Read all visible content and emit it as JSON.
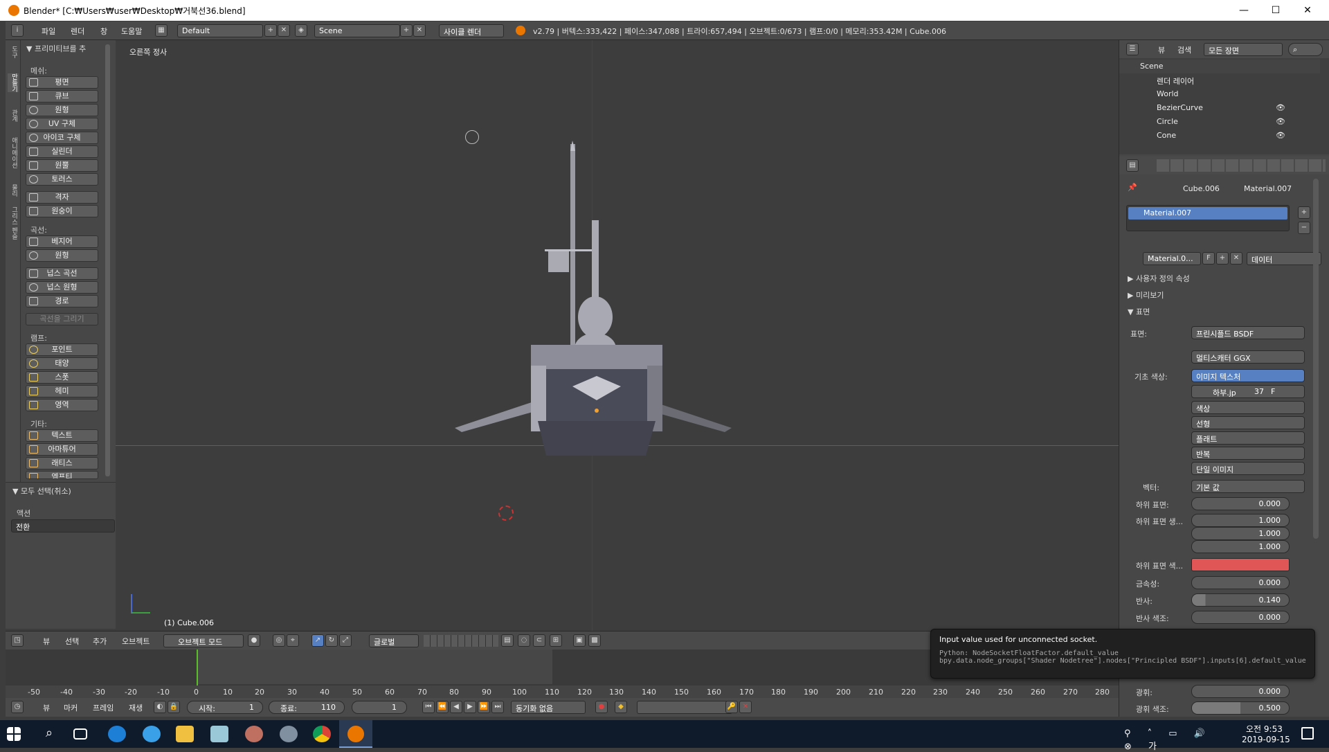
{
  "window": {
    "title": "Blender* [C:₩Users₩user₩Desktop₩거북선36.blend]",
    "min": "—",
    "max": "☐",
    "close": "✕"
  },
  "infobar": {
    "menus": [
      "파일",
      "렌더",
      "창",
      "도움말"
    ],
    "layout": "Default",
    "scene": "Scene",
    "engine": "사이클 렌더",
    "stats": "v2.79 | 버텍스:333,422 | 페이스:347,088 | 트라이:657,494 | 오브젝트:0/673 | 램프:0/0 | 메모리:353.42M | Cube.006"
  },
  "toolshelf": {
    "title": "▼ 프리미티브를 추",
    "mesh_label": "메쉬:",
    "mesh": [
      "평면",
      "큐브",
      "원형",
      "UV 구체",
      "아이코 구체",
      "실린더",
      "원뿔",
      "토러스"
    ],
    "grid": [
      "격자",
      "원숭이"
    ],
    "curve_label": "곡선:",
    "curve": [
      "베지어",
      "원형",
      "넙스 곡선",
      "넙스 원형",
      "경로"
    ],
    "draw_curve": "곡선을 그리기",
    "lamp_label": "램프:",
    "lamp": [
      "포인트",
      "태양",
      "스폿",
      "헤미",
      "영역"
    ],
    "other_label": "기타:",
    "other": [
      "텍스트",
      "아마튜어",
      "래티스",
      "엠프티"
    ],
    "select_all": "▼ 모두 선택(취소)",
    "action_label": "액션",
    "action_value": "전환",
    "tabs": [
      "도구",
      "만들기",
      "관계",
      "애니메이션",
      "물리",
      "그리스 펜슬"
    ]
  },
  "viewport": {
    "view_label": "오른쪽 정사",
    "object_label": "(1) Cube.006"
  },
  "vpheader": {
    "menus": [
      "뷰",
      "선택",
      "추가",
      "오브젝트"
    ],
    "mode": "오브젝트 모드",
    "orient": "글로벌"
  },
  "timeline": {
    "ticks": [
      "-50",
      "-40",
      "-30",
      "-20",
      "-10",
      "0",
      "10",
      "20",
      "30",
      "40",
      "50",
      "60",
      "70",
      "80",
      "90",
      "100",
      "110",
      "120",
      "130",
      "140",
      "150",
      "160",
      "170",
      "180",
      "190",
      "200",
      "210",
      "220",
      "230",
      "240",
      "250",
      "260",
      "270",
      "280"
    ]
  },
  "tlheader": {
    "menus": [
      "뷰",
      "마커",
      "프레임",
      "재생"
    ],
    "start_label": "시작:",
    "start": "1",
    "end_label": "종료:",
    "end": "110",
    "current": "1",
    "sync": "동기화 없음"
  },
  "outliner": {
    "view": "뷰",
    "search": "검색",
    "filter": "모든 장면",
    "rows": [
      "Scene",
      "렌더 레이어",
      "World",
      "BezierCurve",
      "Circle",
      "Cone"
    ]
  },
  "properties": {
    "breadcrumb_obj": "Cube.006",
    "breadcrumb_mat": "Material.007",
    "slot": "Material.007",
    "mat_field": "Material.0...",
    "f": "F",
    "data": "데이터",
    "panel_custom": "▶ 사용자 정의 속성",
    "panel_preview": "▶ 미리보기",
    "panel_surface": "▼ 표면",
    "surface_label": "표면:",
    "surface": "프린시플드 BSDF",
    "distribution": "멀티스캐터 GGX",
    "base_label": "기초 색상:",
    "base": "이미지 텍스처",
    "img_name": "하부.jp",
    "img_users": "37",
    "img_f": "F",
    "color": "색상",
    "interp": "선형",
    "proj": "플래트",
    "ext": "반복",
    "src": "단일 이미지",
    "vector_label": "벡터:",
    "vector": "기본 값",
    "rows": [
      {
        "label": "하위 표면:",
        "value": "0.000"
      },
      {
        "label": "하위 표면 생...",
        "value": "1.000"
      },
      {
        "label": "",
        "value": "1.000"
      },
      {
        "label": "",
        "value": "1.000"
      },
      {
        "label": "하위 표면 색...",
        "value": ""
      },
      {
        "label": "금속성:",
        "value": "0.000"
      },
      {
        "label": "반사:",
        "value": "0.140"
      },
      {
        "label": "반사 색조:",
        "value": "0.000"
      },
      {
        "label": "광휘:",
        "value": "0.000"
      },
      {
        "label": "광휘 색조:",
        "value": "0.500"
      }
    ],
    "subsurface_color": "#e05555"
  },
  "tooltip": {
    "line1": "Input value used for unconnected socket.",
    "line2": "Python: NodeSocketFloatFactor.default_value",
    "line3": "bpy.data.node_groups[\"Shader Nodetree\"].nodes[\"Principled BSDF\"].inputs[6].default_value"
  },
  "taskbar": {
    "time": "오전 9:53",
    "date": "2019-09-15"
  }
}
